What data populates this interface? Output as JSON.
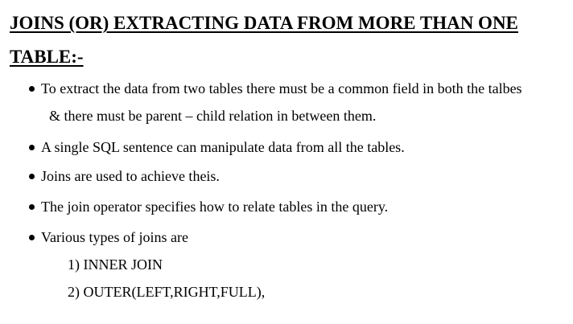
{
  "document": {
    "title_line1": "JOINS (OR) EXTRACTING DATA FROM MORE THAN ONE",
    "title_line2": "TABLE:-",
    "bullets": [
      {
        "text": "To extract the data from two tables there must be a common field in both the talbes",
        "continuation": "& there must be parent – child relation in between them."
      },
      {
        "text": "A single SQL sentence can manipulate data from all the tables."
      },
      {
        "text": "Joins are used to achieve theis."
      },
      {
        "text": "The join operator specifies how to relate tables in the query."
      },
      {
        "text": "Various types of joins are"
      }
    ],
    "join_types": [
      "1)  INNER JOIN",
      "2) OUTER(LEFT,RIGHT,FULL),"
    ]
  }
}
